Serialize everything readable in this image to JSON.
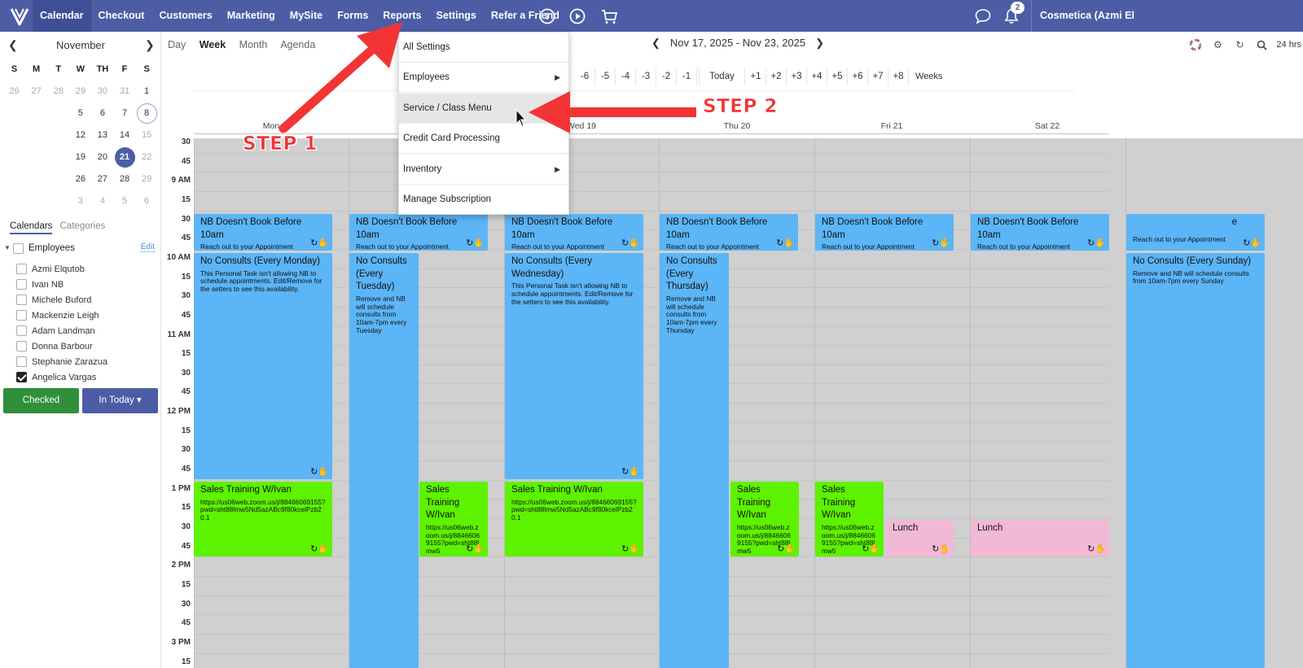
{
  "nav": {
    "items": [
      "Calendar",
      "Checkout",
      "Customers",
      "Marketing",
      "MySite",
      "Forms",
      "Reports",
      "Settings",
      "Refer a Friend"
    ],
    "notif_count": "2",
    "account": "Cosmetica (Azmi El"
  },
  "mini": {
    "month": "November",
    "weekdays": [
      "S",
      "M",
      "T",
      "W",
      "TH",
      "F",
      "S"
    ],
    "weeks": [
      [
        "26",
        "27",
        "28",
        "29",
        "30",
        "31",
        "1"
      ],
      [
        "",
        "",
        "",
        "5",
        "6",
        "7",
        "8"
      ],
      [
        "",
        "",
        "",
        "12",
        "13",
        "14",
        "15"
      ],
      [
        "",
        "",
        "",
        "19",
        "20",
        "21",
        "22"
      ],
      [
        "",
        "",
        "",
        "26",
        "27",
        "28",
        "29"
      ],
      [
        "",
        "",
        "",
        "3",
        "4",
        "5",
        "6"
      ]
    ]
  },
  "calendars": {
    "tab_active": "Calendars",
    "tab_other": "Categories",
    "group": "Employees",
    "edit": "Edit",
    "employees": [
      "Azmi Elqutob",
      "Ivan NB",
      "Michele Buford",
      "Mackenzie Leigh",
      "Adam Landman",
      "Donna Barbour",
      "Stephanie Zarazua",
      "Angelica Vargas"
    ],
    "checked_index": 7
  },
  "buttons": {
    "checked": "Checked",
    "in_today": "In Today ▾"
  },
  "views": {
    "day": "Day",
    "week": "Week",
    "month": "Month",
    "agenda": "Agenda"
  },
  "date_range": "Nov 17, 2025 - Nov 23, 2025",
  "hrs_label": "24 hrs",
  "week_jump": {
    "minus": [
      "-6",
      "-5",
      "-4",
      "-3",
      "-2",
      "-1"
    ],
    "today": "Today",
    "plus": [
      "+1",
      "+2",
      "+3",
      "+4",
      "+5",
      "+6",
      "+7",
      "+8"
    ],
    "label": "Weeks"
  },
  "days": [
    "Mon",
    "Wed 19",
    "Thu 20",
    "Fri 21",
    "Sat 22"
  ],
  "times": [
    "30",
    "45",
    "9 AM",
    "15",
    "30",
    "45",
    "10 AM",
    "15",
    "30",
    "45",
    "11 AM",
    "15",
    "30",
    "45",
    "12 PM",
    "15",
    "30",
    "45",
    "1 PM",
    "15",
    "30",
    "45",
    "2 PM",
    "15",
    "30",
    "45",
    "3 PM",
    "15"
  ],
  "events": {
    "nb_title": "NB Doesn't Book Before 10am",
    "nb_desc": "Reach out to your Appointment",
    "nb_sun_title": "e",
    "mon_title": "No Consults (Every Monday)",
    "mon_desc": "This Personal Task isn't allowing NB to schedule appointments. Edit/Remove for the setters to see this availability.",
    "tue_title": "No Consults (Every Tuesday)",
    "tue_desc": "Remove and NB will schedule consults from 10am-7pm every Tuesday",
    "wed_title": "No Consults (Every Wednesday)",
    "wed_desc": "This Personal Task isn't allowing NB to schedule appointments. Edit/Remove for the setters to see this availability.",
    "thu_title": "No Consults (Every Thursday)",
    "thu_desc": "Remove and NB will schedule consults from 10am-7pm every Thursday",
    "sun_title": "No Consults (Every Sunday)",
    "sun_desc": "Remove and NB will schedule consults from 10am-7pm every Sunday",
    "sales_title": "Sales Training W/Ivan",
    "sales_link": "https://us06web.zoom.us/j/88466069155?pwd=sht88lmw5Nd5azABc9f80kcelPzb20.1",
    "sales_link_short": "https://us06web.zoom.us/j/88466069155?pwd=sht88lmw5",
    "lunch": "Lunch"
  },
  "dropdown": {
    "items": [
      "All Settings",
      "Employees",
      "Service / Class Menu",
      "Credit Card Processing",
      "Inventory",
      "Manage Subscription"
    ]
  },
  "annotations": {
    "step1": "STEP 1",
    "step2": "STEP 2"
  },
  "colors": {
    "nav": "#4c5da6",
    "event_blue": "#5bb5f7",
    "event_green": "#5df200",
    "event_pink": "#f2b9d6",
    "arrow_red": "#f23434"
  }
}
